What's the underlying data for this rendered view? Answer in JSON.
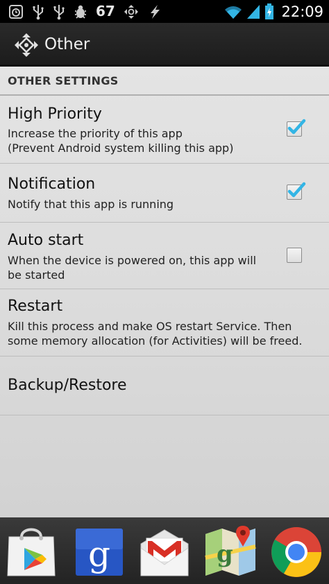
{
  "status_bar": {
    "battery_level": "67",
    "time": "22:09",
    "icons": [
      "alarm-icon",
      "usb-icon",
      "usb-icon",
      "debug-icon",
      "app-icon",
      "charging-icon",
      "wifi-icon",
      "signal-icon",
      "battery-icon"
    ]
  },
  "action_bar": {
    "title": "Other",
    "icon": "move-arrows-icon"
  },
  "section": {
    "header": "OTHER SETTINGS"
  },
  "preferences": [
    {
      "title": "High Priority",
      "summary": "Increase the priority of this app\n(Prevent Android system killing this app)",
      "checked": true
    },
    {
      "title": "Notification",
      "summary": "Notify that this app is running",
      "checked": true
    },
    {
      "title": "Auto start",
      "summary": "When the device is powered on, this app will\nbe started",
      "checked": false
    },
    {
      "title": "Restart",
      "summary": "Kill this process and make OS restart Service. Then\nsome memory allocation (for Activities) will be freed."
    },
    {
      "title": "Backup/Restore"
    }
  ],
  "dock": {
    "apps": [
      "play-store-icon",
      "google-search-icon",
      "gmail-icon",
      "maps-icon",
      "chrome-icon"
    ]
  },
  "colors": {
    "accent_check": "#33b5e5",
    "action_bar": "#1f1f1f",
    "background": "#dcdcdc"
  }
}
